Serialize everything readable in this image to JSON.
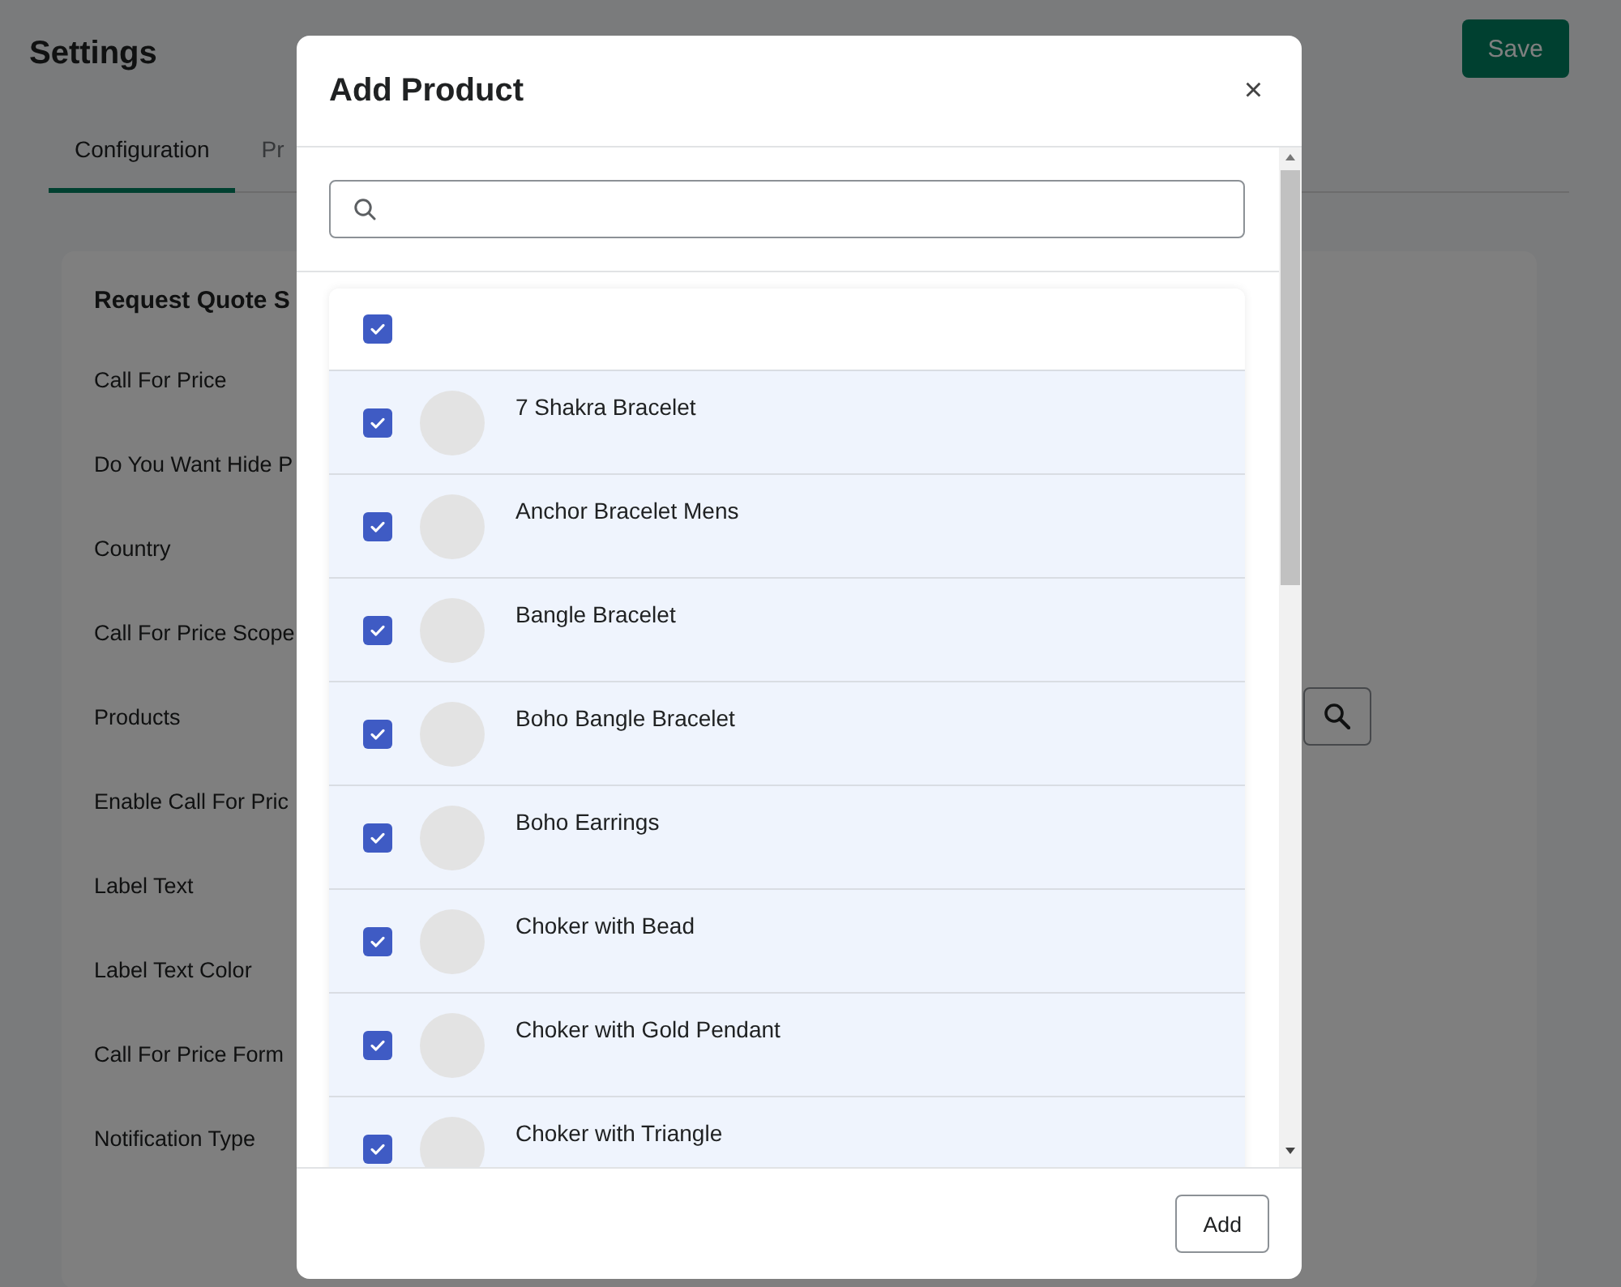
{
  "page": {
    "title": "Settings",
    "save_button": "Save",
    "tabs": [
      {
        "label": "Configuration",
        "selected": true
      },
      {
        "label": "Pr",
        "selected": false
      }
    ],
    "card": {
      "title": "Request Quote S",
      "fields": [
        {
          "label": "Call For Price",
          "kind": "text"
        },
        {
          "label": "Do You Want Hide P",
          "kind": "text"
        },
        {
          "label": "Country",
          "kind": "text"
        },
        {
          "label": "Call For Price Scope",
          "kind": "text"
        },
        {
          "label": "Products",
          "kind": "picker"
        },
        {
          "label": "Enable Call For Pric",
          "kind": "text"
        },
        {
          "label": "Label Text",
          "kind": "text"
        },
        {
          "label": "Label Text Color",
          "kind": "text"
        },
        {
          "label": "Call For Price Form",
          "kind": "text"
        },
        {
          "label": "Notification Type",
          "kind": "text"
        }
      ]
    }
  },
  "modal": {
    "title": "Add Product",
    "close": "×",
    "select_all": {
      "checked": true
    },
    "products": [
      {
        "name": "7 Shakra Bracelet",
        "checked": true
      },
      {
        "name": "Anchor Bracelet Mens",
        "checked": true
      },
      {
        "name": "Bangle Bracelet",
        "checked": true
      },
      {
        "name": "Boho Bangle Bracelet",
        "checked": true
      },
      {
        "name": "Boho Earrings",
        "checked": true
      },
      {
        "name": "Choker with Bead",
        "checked": true
      },
      {
        "name": "Choker with Gold Pendant",
        "checked": true
      },
      {
        "name": "Choker with Triangle",
        "checked": true
      }
    ],
    "add_button": "Add"
  }
}
